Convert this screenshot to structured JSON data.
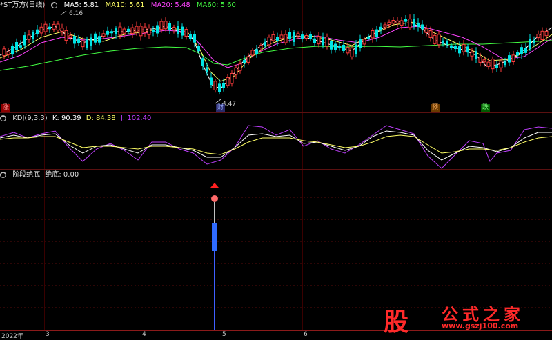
{
  "main_panel": {
    "title": "*ST万方(日线)",
    "ma5": "MA5: 5.81",
    "ma10": "MA10: 5.61",
    "ma20": "MA20: 5.48",
    "ma60": "MA60: 5.60",
    "high_label": "6.16",
    "low_label": "4.47",
    "tag_zhang": "涨",
    "tag_cai": "财",
    "tag_yu": "预",
    "tag_die": "跌"
  },
  "kdj_panel": {
    "title": "KDJ(9,3,3)",
    "k": "K: 90.39",
    "d": "D: 84.38",
    "j": "J: 102.40"
  },
  "signal_panel": {
    "title": "阶段绝底",
    "value": "绝底: 0.00"
  },
  "x_axis": {
    "labels": [
      "2022年",
      "3",
      "4",
      "5",
      "6"
    ]
  },
  "watermark": {
    "logo": "股",
    "name": "公式之家",
    "url": "www.gszj100.com"
  },
  "colors": {
    "up": "#ff3c3c",
    "down": "#00e5e5",
    "ma5": "#ffffff",
    "ma10": "#ffff66",
    "ma20": "#ff44ff",
    "ma60": "#44ff44",
    "signal_bar": "#3366ff"
  }
}
